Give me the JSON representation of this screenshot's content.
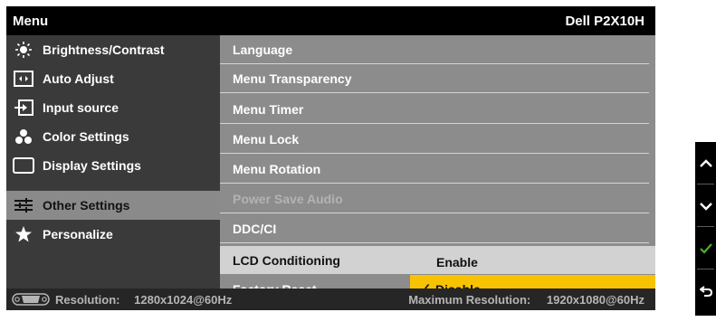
{
  "header": {
    "title": "Menu",
    "model": "Dell P2X10H"
  },
  "left_menu": [
    {
      "label": "Brightness/Contrast",
      "icon": "brightness-icon"
    },
    {
      "label": "Auto Adjust",
      "icon": "auto-adjust-icon"
    },
    {
      "label": "Input source",
      "icon": "input-source-icon"
    },
    {
      "label": "Color Settings",
      "icon": "color-settings-icon"
    },
    {
      "label": "Display Settings",
      "icon": "display-settings-icon"
    },
    {
      "label": "Other Settings",
      "icon": "sliders-icon",
      "selected": true
    },
    {
      "label": "Personalize",
      "icon": "star-icon"
    }
  ],
  "right_menu": [
    {
      "label": "Language"
    },
    {
      "label": "Menu Transparency"
    },
    {
      "label": "Menu Timer"
    },
    {
      "label": "Menu Lock"
    },
    {
      "label": "Menu Rotation"
    },
    {
      "label": "Power Save Audio",
      "disabled": true
    },
    {
      "label": "DDC/CI"
    }
  ],
  "lcd_conditioning": {
    "label": "LCD Conditioning",
    "option_enable": "Enable",
    "option_disable": "Disable",
    "selected": "Disable"
  },
  "factory_reset": {
    "label": "Factory Reset"
  },
  "footer": {
    "resolution_label": "Resolution:",
    "resolution_value": "1280x1024@60Hz",
    "max_label": "Maximum Resolution:",
    "max_value": "1920x1080@60Hz"
  },
  "side_buttons": [
    "up-arrow-icon",
    "down-arrow-icon",
    "check-icon",
    "back-icon"
  ],
  "colors": {
    "highlight": "#f7c200",
    "panel": "#8c8c8c",
    "left_panel": "#3a3a3a",
    "check": "#4caf2a"
  }
}
